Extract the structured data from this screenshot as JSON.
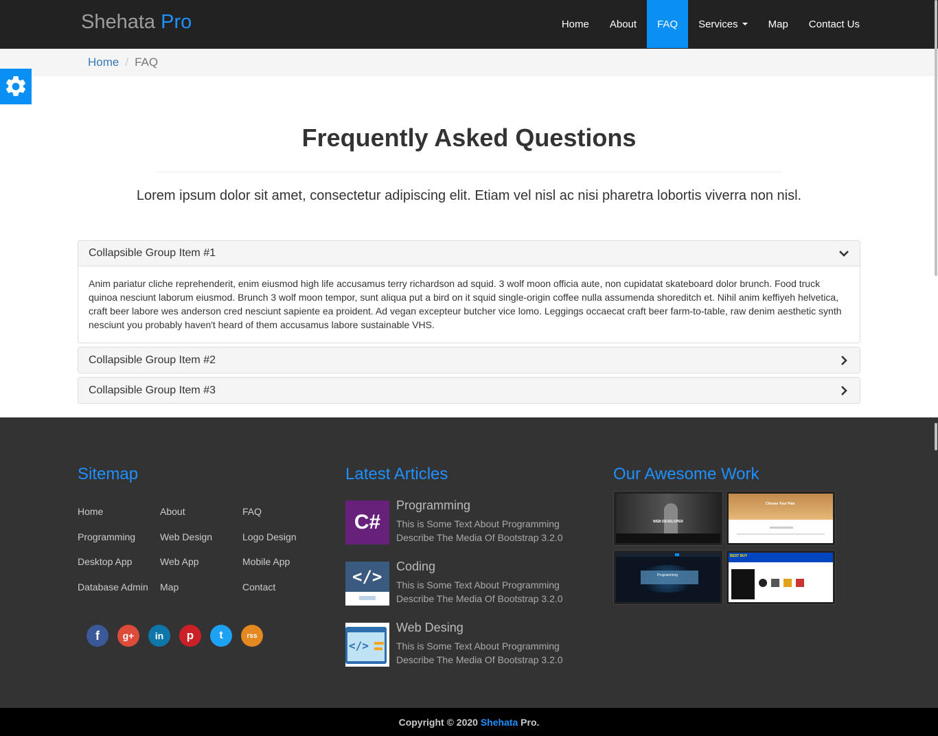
{
  "navbar": {
    "brand_part1": "Shehata",
    "brand_part2": "Pro",
    "items": [
      {
        "label": "Home"
      },
      {
        "label": "About"
      },
      {
        "label": "FAQ",
        "active": true
      },
      {
        "label": "Services",
        "dropdown": true
      },
      {
        "label": "Map"
      },
      {
        "label": "Contact Us"
      }
    ]
  },
  "breadcrumb": {
    "home": "Home",
    "current": "FAQ"
  },
  "page": {
    "title": "Frequently Asked Questions",
    "lead": "Lorem ipsum dolor sit amet, consectetur adipiscing elit. Etiam vel nisl ac nisi pharetra lobortis viverra non nisl."
  },
  "accordion": [
    {
      "title": "Collapsible Group Item #1",
      "open": true,
      "body": "Anim pariatur cliche reprehenderit, enim eiusmod high life accusamus terry richardson ad squid. 3 wolf moon officia aute, non cupidatat skateboard dolor brunch. Food truck quinoa nesciunt laborum eiusmod. Brunch 3 wolf moon tempor, sunt aliqua put a bird on it squid single-origin coffee nulla assumenda shoreditch et. Nihil anim keffiyeh helvetica, craft beer labore wes anderson cred nesciunt sapiente ea proident. Ad vegan excepteur butcher vice lomo. Leggings occaecat craft beer farm-to-table, raw denim aesthetic synth nesciunt you probably haven't heard of them accusamus labore sustainable VHS."
    },
    {
      "title": "Collapsible Group Item #2",
      "open": false
    },
    {
      "title": "Collapsible Group Item #3",
      "open": false
    }
  ],
  "footer": {
    "sitemap_title": "Sitemap",
    "sitemap_links": [
      [
        "Home",
        "About",
        "FAQ"
      ],
      [
        "Programming",
        "Web Design",
        "Logo Design"
      ],
      [
        "Desktop App",
        "Web App",
        "Mobile App"
      ],
      [
        "Database Admin",
        "Map",
        "Contact"
      ]
    ],
    "social": [
      {
        "icon": "facebook-icon",
        "glyph": "f",
        "color": "#3b5998"
      },
      {
        "icon": "google-plus-icon",
        "glyph": "g+",
        "color": "#dd4b39"
      },
      {
        "icon": "linkedin-icon",
        "glyph": "in",
        "color": "#0e76a8"
      },
      {
        "icon": "pinterest-icon",
        "glyph": "p",
        "color": "#cb2027"
      },
      {
        "icon": "twitter-icon",
        "glyph": "t",
        "color": "#1da1f2"
      },
      {
        "icon": "rss-icon",
        "glyph": "rss",
        "color": "#f26522"
      }
    ],
    "articles_title": "Latest Articles",
    "articles": [
      {
        "title": "Programming",
        "text": "This is Some Text About Programming Describe The Media Of Bootstrap 3.2.0",
        "thumb_label": "C#"
      },
      {
        "title": "Coding",
        "text": "This is Some Text About Programming Describe The Media Of Bootstrap 3.2.0",
        "thumb_label": "</>"
      },
      {
        "title": "Web Desing",
        "text": "This is Some Text About Programming Describe The Media Of Bootstrap 3.2.0",
        "thumb_label": "</>"
      }
    ],
    "work_title": "Our Awesome Work",
    "work_captions": [
      "WEB DEVELOPER",
      "Choose Your Plan",
      "Programming",
      "BEST BUY"
    ]
  },
  "copyright": {
    "prefix": "Copyright © 2020",
    "brand": "Shehata",
    "suffix": "Pro."
  },
  "colors": {
    "accent": "#1e90ff",
    "nav_active": "#0a8ff5",
    "navbar_bg": "#222222",
    "footer_bg": "#333333"
  }
}
